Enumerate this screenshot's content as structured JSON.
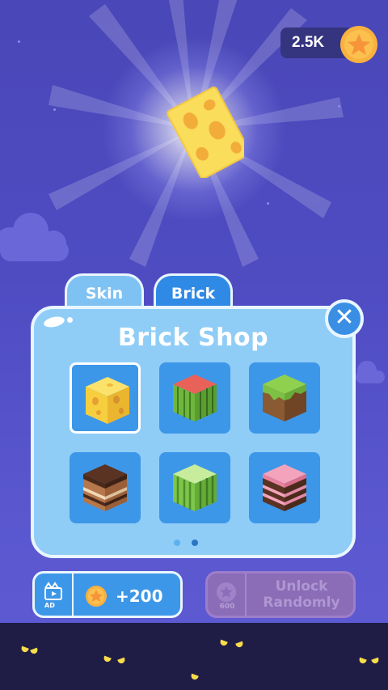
{
  "hud": {
    "coins": "2.5K",
    "coin_icon": "star-coin-icon"
  },
  "tabs": [
    {
      "label": "Skin",
      "active": false
    },
    {
      "label": "Brick",
      "active": true
    }
  ],
  "shop": {
    "title": "Brick Shop",
    "items": [
      {
        "name": "cheese-brick",
        "icon": "cheese-cube-icon",
        "selected": true
      },
      {
        "name": "watermelon-brick",
        "icon": "watermelon-cube-icon",
        "selected": false
      },
      {
        "name": "grass-dirt-brick",
        "icon": "grass-cube-icon",
        "selected": false
      },
      {
        "name": "chocolate-cake-brick",
        "icon": "chocolate-cake-cube-icon",
        "selected": false
      },
      {
        "name": "melon-green-brick",
        "icon": "melon-cube-icon",
        "selected": false
      },
      {
        "name": "strawberry-cake-brick",
        "icon": "strawberry-cake-cube-icon",
        "selected": false
      }
    ],
    "page_count": 2,
    "current_page": 2
  },
  "buttons": {
    "ad_reward": {
      "ad_label": "AD",
      "amount": "+200"
    },
    "unlock": {
      "price": "600",
      "label_line1": "Unlock",
      "label_line2": "Randomly"
    }
  },
  "colors": {
    "sky": "#4f4cc2",
    "panel": "#8fcdf7",
    "tab_active": "#2f8ae6",
    "cell": "#3d97e8",
    "coin": "#f7a93a",
    "ground": "#1f1d45"
  }
}
